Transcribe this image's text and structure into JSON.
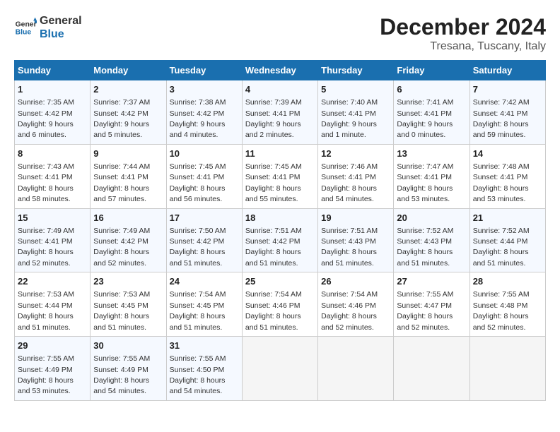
{
  "header": {
    "logo_line1": "General",
    "logo_line2": "Blue",
    "main_title": "December 2024",
    "subtitle": "Tresana, Tuscany, Italy"
  },
  "days_of_week": [
    "Sunday",
    "Monday",
    "Tuesday",
    "Wednesday",
    "Thursday",
    "Friday",
    "Saturday"
  ],
  "weeks": [
    [
      {
        "day": "1",
        "sunrise": "7:35 AM",
        "sunset": "4:42 PM",
        "daylight": "9 hours and 6 minutes."
      },
      {
        "day": "2",
        "sunrise": "7:37 AM",
        "sunset": "4:42 PM",
        "daylight": "9 hours and 5 minutes."
      },
      {
        "day": "3",
        "sunrise": "7:38 AM",
        "sunset": "4:42 PM",
        "daylight": "9 hours and 4 minutes."
      },
      {
        "day": "4",
        "sunrise": "7:39 AM",
        "sunset": "4:41 PM",
        "daylight": "9 hours and 2 minutes."
      },
      {
        "day": "5",
        "sunrise": "7:40 AM",
        "sunset": "4:41 PM",
        "daylight": "9 hours and 1 minute."
      },
      {
        "day": "6",
        "sunrise": "7:41 AM",
        "sunset": "4:41 PM",
        "daylight": "9 hours and 0 minutes."
      },
      {
        "day": "7",
        "sunrise": "7:42 AM",
        "sunset": "4:41 PM",
        "daylight": "8 hours and 59 minutes."
      }
    ],
    [
      {
        "day": "8",
        "sunrise": "7:43 AM",
        "sunset": "4:41 PM",
        "daylight": "8 hours and 58 minutes."
      },
      {
        "day": "9",
        "sunrise": "7:44 AM",
        "sunset": "4:41 PM",
        "daylight": "8 hours and 57 minutes."
      },
      {
        "day": "10",
        "sunrise": "7:45 AM",
        "sunset": "4:41 PM",
        "daylight": "8 hours and 56 minutes."
      },
      {
        "day": "11",
        "sunrise": "7:45 AM",
        "sunset": "4:41 PM",
        "daylight": "8 hours and 55 minutes."
      },
      {
        "day": "12",
        "sunrise": "7:46 AM",
        "sunset": "4:41 PM",
        "daylight": "8 hours and 54 minutes."
      },
      {
        "day": "13",
        "sunrise": "7:47 AM",
        "sunset": "4:41 PM",
        "daylight": "8 hours and 53 minutes."
      },
      {
        "day": "14",
        "sunrise": "7:48 AM",
        "sunset": "4:41 PM",
        "daylight": "8 hours and 53 minutes."
      }
    ],
    [
      {
        "day": "15",
        "sunrise": "7:49 AM",
        "sunset": "4:41 PM",
        "daylight": "8 hours and 52 minutes."
      },
      {
        "day": "16",
        "sunrise": "7:49 AM",
        "sunset": "4:42 PM",
        "daylight": "8 hours and 52 minutes."
      },
      {
        "day": "17",
        "sunrise": "7:50 AM",
        "sunset": "4:42 PM",
        "daylight": "8 hours and 51 minutes."
      },
      {
        "day": "18",
        "sunrise": "7:51 AM",
        "sunset": "4:42 PM",
        "daylight": "8 hours and 51 minutes."
      },
      {
        "day": "19",
        "sunrise": "7:51 AM",
        "sunset": "4:43 PM",
        "daylight": "8 hours and 51 minutes."
      },
      {
        "day": "20",
        "sunrise": "7:52 AM",
        "sunset": "4:43 PM",
        "daylight": "8 hours and 51 minutes."
      },
      {
        "day": "21",
        "sunrise": "7:52 AM",
        "sunset": "4:44 PM",
        "daylight": "8 hours and 51 minutes."
      }
    ],
    [
      {
        "day": "22",
        "sunrise": "7:53 AM",
        "sunset": "4:44 PM",
        "daylight": "8 hours and 51 minutes."
      },
      {
        "day": "23",
        "sunrise": "7:53 AM",
        "sunset": "4:45 PM",
        "daylight": "8 hours and 51 minutes."
      },
      {
        "day": "24",
        "sunrise": "7:54 AM",
        "sunset": "4:45 PM",
        "daylight": "8 hours and 51 minutes."
      },
      {
        "day": "25",
        "sunrise": "7:54 AM",
        "sunset": "4:46 PM",
        "daylight": "8 hours and 51 minutes."
      },
      {
        "day": "26",
        "sunrise": "7:54 AM",
        "sunset": "4:46 PM",
        "daylight": "8 hours and 52 minutes."
      },
      {
        "day": "27",
        "sunrise": "7:55 AM",
        "sunset": "4:47 PM",
        "daylight": "8 hours and 52 minutes."
      },
      {
        "day": "28",
        "sunrise": "7:55 AM",
        "sunset": "4:48 PM",
        "daylight": "8 hours and 52 minutes."
      }
    ],
    [
      {
        "day": "29",
        "sunrise": "7:55 AM",
        "sunset": "4:49 PM",
        "daylight": "8 hours and 53 minutes."
      },
      {
        "day": "30",
        "sunrise": "7:55 AM",
        "sunset": "4:49 PM",
        "daylight": "8 hours and 54 minutes."
      },
      {
        "day": "31",
        "sunrise": "7:55 AM",
        "sunset": "4:50 PM",
        "daylight": "8 hours and 54 minutes."
      },
      null,
      null,
      null,
      null
    ]
  ]
}
